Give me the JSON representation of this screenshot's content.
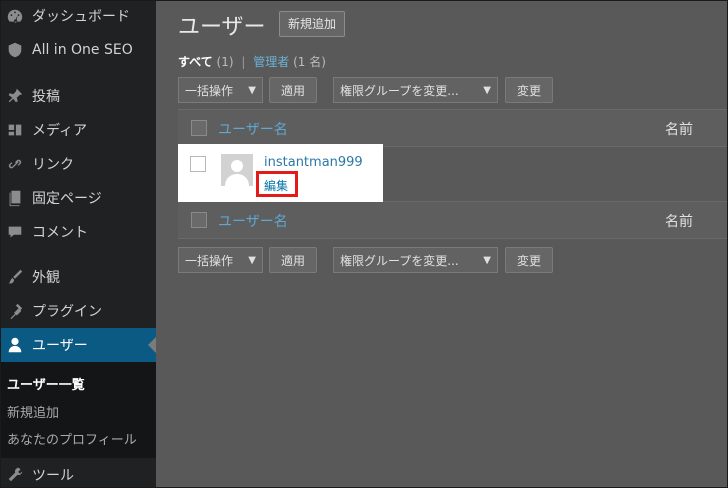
{
  "sidebar": {
    "items": [
      {
        "label": "ダッシュボード",
        "icon": "dashboard-icon"
      },
      {
        "label": "All in One SEO",
        "icon": "shield-icon"
      },
      {
        "label": "投稿",
        "icon": "pin-icon"
      },
      {
        "label": "メディア",
        "icon": "media-icon"
      },
      {
        "label": "リンク",
        "icon": "link-icon"
      },
      {
        "label": "固定ページ",
        "icon": "page-icon"
      },
      {
        "label": "コメント",
        "icon": "comment-icon"
      },
      {
        "label": "外観",
        "icon": "brush-icon"
      },
      {
        "label": "プラグイン",
        "icon": "plugin-icon"
      },
      {
        "label": "ユーザー",
        "icon": "user-icon"
      },
      {
        "label": "ツール",
        "icon": "wrench-icon"
      }
    ],
    "submenu": [
      {
        "label": "ユーザー一覧"
      },
      {
        "label": "新規追加"
      },
      {
        "label": "あなたのプロフィール"
      }
    ]
  },
  "main": {
    "title": "ユーザー",
    "add_new": "新規追加",
    "filters": {
      "all": "すべて",
      "all_count": "(1)",
      "separator": "|",
      "admin": "管理者",
      "admin_count": "(1 名)"
    },
    "bulk_action": "一括操作",
    "apply": "適用",
    "role_change": "権限グループを変更...",
    "change": "変更",
    "columns": {
      "username": "ユーザー名",
      "name": "名前"
    },
    "user": {
      "username": "instantman999",
      "edit": "編集"
    }
  },
  "colors": {
    "sidebar_bg": "#1f2123",
    "active_bg": "#0b5a83",
    "highlight_border": "#e31b1b",
    "link": "#2a78a8"
  }
}
